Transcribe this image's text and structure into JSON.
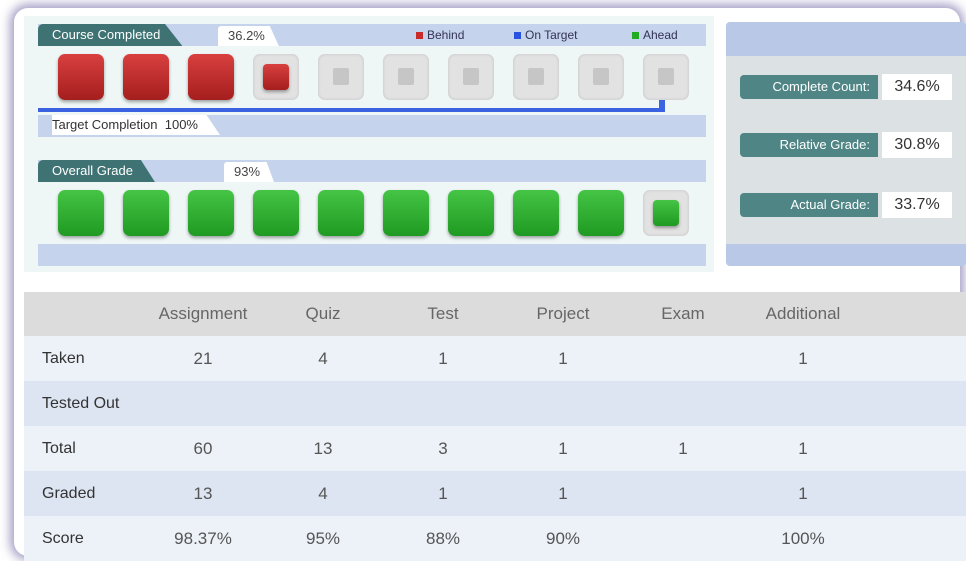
{
  "course_completed": {
    "title": "Course Completed",
    "percent": "36.2%",
    "blocks": [
      "full",
      "full",
      "full",
      "partial",
      "empty",
      "empty",
      "empty",
      "empty",
      "empty",
      "empty"
    ],
    "target_label": "Target Completion",
    "target_percent": "100%",
    "target_fraction": 1.0
  },
  "legend": {
    "behind": {
      "label": "Behind",
      "color": "#c92a2a"
    },
    "on_target": {
      "label": "On Target",
      "color": "#2a52e0"
    },
    "ahead": {
      "label": "Ahead",
      "color": "#22aa22"
    }
  },
  "overall_grade": {
    "title": "Overall Grade",
    "percent": "93%",
    "blocks": [
      "full",
      "full",
      "full",
      "full",
      "full",
      "full",
      "full",
      "full",
      "full",
      "partial"
    ]
  },
  "metrics": [
    {
      "label": "Complete Count:",
      "value": "34.6%"
    },
    {
      "label": "Relative Grade:",
      "value": "30.8%"
    },
    {
      "label": "Actual Grade:",
      "value": "33.7%"
    }
  ],
  "table": {
    "columns": [
      "",
      "Assignment",
      "Quiz",
      "Test",
      "Project",
      "Exam",
      "Additional"
    ],
    "rows": [
      {
        "label": "Taken",
        "cells": [
          "21",
          "4",
          "1",
          "1",
          "",
          "1"
        ]
      },
      {
        "label": "Tested Out",
        "cells": [
          "",
          "",
          "",
          "",
          "",
          ""
        ]
      },
      {
        "label": "Total",
        "cells": [
          "60",
          "13",
          "3",
          "1",
          "1",
          "1"
        ]
      },
      {
        "label": "Graded",
        "cells": [
          "13",
          "4",
          "1",
          "1",
          "",
          "1"
        ]
      },
      {
        "label": "Score",
        "cells": [
          "98.37%",
          "95%",
          "88%",
          "90%",
          "",
          "100%"
        ]
      }
    ]
  }
}
